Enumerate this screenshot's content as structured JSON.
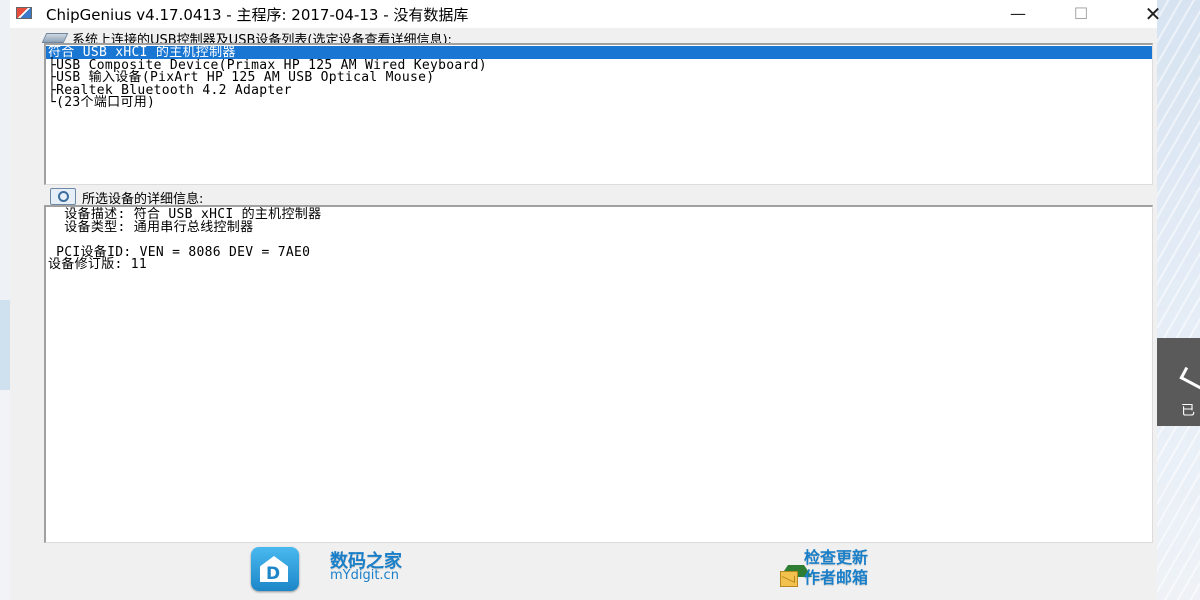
{
  "window": {
    "title": "ChipGenius v4.17.0413 - 主程序: 2017-04-13 - 没有数据库",
    "controls": {
      "minimize": "—",
      "maximize": "☐",
      "close": "✕"
    }
  },
  "device_list": {
    "label": "系统上连接的USB控制器及USB设备列表(选定设备查看详细信息):",
    "items": [
      {
        "text": "符合 USB xHCI 的主机控制器",
        "prefix": "",
        "selected": true
      },
      {
        "text": "USB Composite Device(Primax HP 125 AM Wired Keyboard)",
        "prefix": "├"
      },
      {
        "text": "USB 输入设备(PixArt HP 125 AM USB Optical Mouse)",
        "prefix": "├"
      },
      {
        "text": "Realtek Bluetooth 4.2 Adapter",
        "prefix": "├"
      },
      {
        "text": "(23个端口可用)",
        "prefix": "└"
      }
    ]
  },
  "details": {
    "label": "所选设备的详细信息:",
    "lines": [
      "  设备描述: 符合 USB xHCI 的主机控制器",
      "  设备类型: 通用串行总线控制器",
      "",
      " PCI设备ID: VEN = 8086 DEV = 7AE0",
      "设备修订版: 11"
    ]
  },
  "footer": {
    "logo_letter": "D",
    "brand_cn": "数码之家",
    "brand_en": "mYdigit.cn",
    "check_update": "检查更新",
    "author_email": "作者邮箱"
  },
  "toast": {
    "text": "已"
  }
}
